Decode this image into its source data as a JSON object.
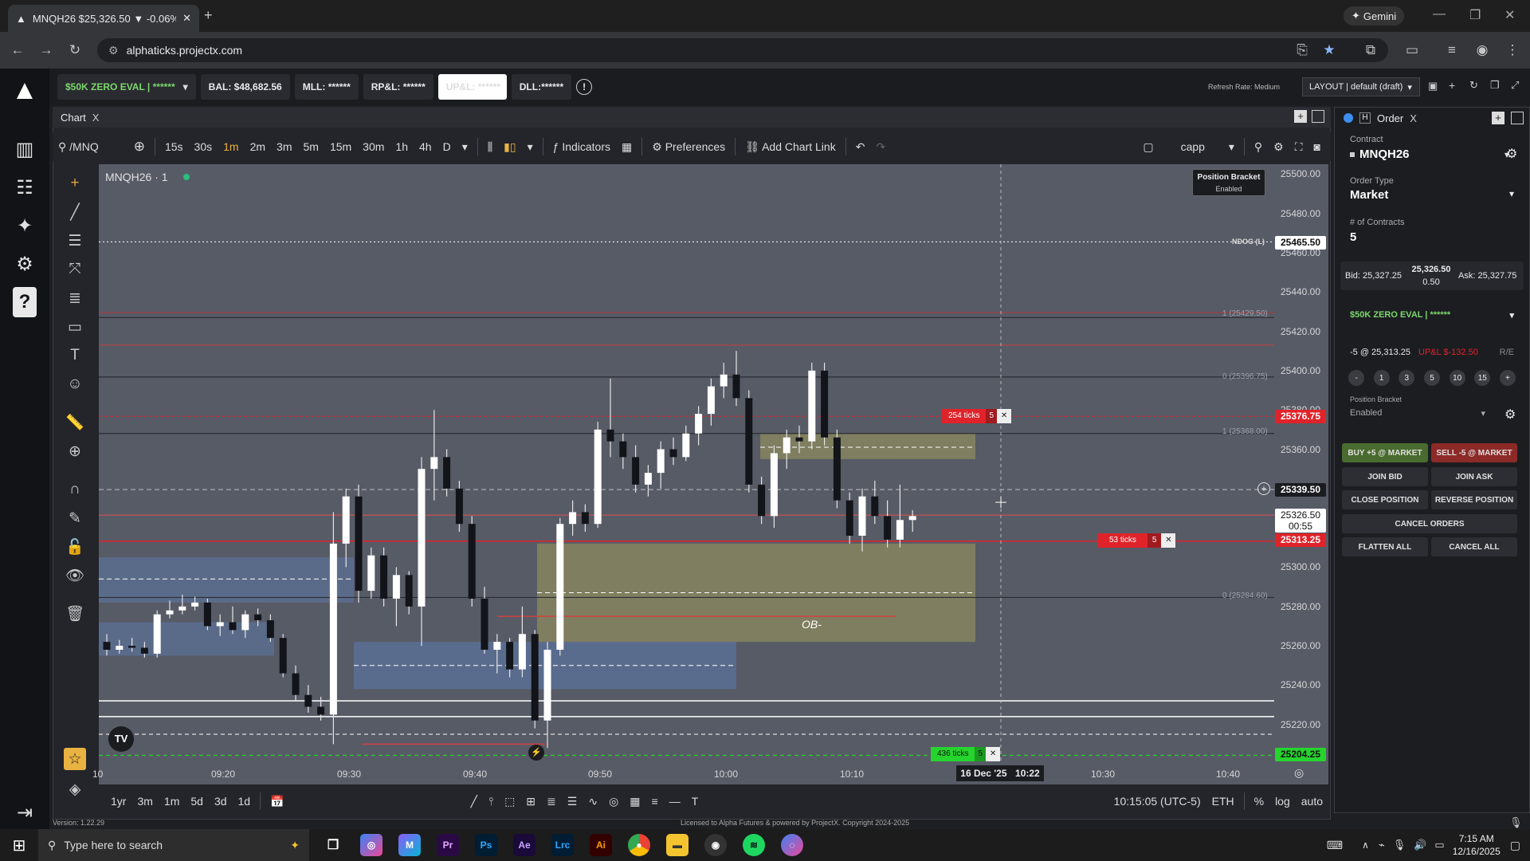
{
  "browser": {
    "tab_title": "MNQH26 $25,326.50 ▼ -0.06%",
    "url": "alphaticks.projectx.com",
    "gemini": "Gemini"
  },
  "account": {
    "name": "$50K ZERO EVAL | ******",
    "bal": "BAL: $48,682.56",
    "mll": "MLL: ******",
    "rpl": "RP&L: ******",
    "upl": "UP&L: ******",
    "dll": "DLL:******",
    "refresh": "Refresh Rate: Medium",
    "layout": "LAYOUT | default (draft)"
  },
  "chart": {
    "tab": "Chart",
    "symbol": "/MNQ",
    "intervals": [
      "15s",
      "30s",
      "1m",
      "2m",
      "3m",
      "5m",
      "15m",
      "30m",
      "1h",
      "4h",
      "D"
    ],
    "active_interval": "1m",
    "indicators": "Indicators",
    "preferences": "Preferences",
    "add_link": "Add Chart Link",
    "template": "capp",
    "legend": "MNQH26 · 1",
    "bracket_note_title": "Position Bracket",
    "bracket_note_sub": "Enabled",
    "ob_label": "OB-",
    "ndog": "NDOG (L)",
    "tag_254": "254 ticks",
    "tag_53": "53 ticks",
    "tag_436": "436 ticks",
    "qty5": "5",
    "price_labels": [
      "25500.00",
      "25480.00",
      "25460.00",
      "25440.00",
      "25420.00",
      "25400.00",
      "25380.00",
      "25360.00",
      "25340.00",
      "25320.00",
      "25300.00",
      "25280.00",
      "25260.00",
      "25240.00",
      "25220.00"
    ],
    "tags": {
      "ndog": "25465.50",
      "r1": "25376.75",
      "cross": "25339.50",
      "last": "25326.50",
      "countdown": "00:55",
      "entry": "25313.25",
      "low": "25204.25"
    },
    "fib_labels": [
      "1 (25429.50)",
      "0 (25396.75)",
      "1 (25368.00)",
      "0 (25284.60)"
    ],
    "time_labels": [
      "10",
      "09:20",
      "09:30",
      "09:40",
      "09:50",
      "10:00",
      "10:10",
      "10:20",
      "10:30",
      "10:40"
    ],
    "cursor_date": "16 Dec '25",
    "cursor_time": "10:22",
    "ranges": [
      "1yr",
      "3m",
      "1m",
      "5d",
      "3d",
      "1d"
    ],
    "clock": "10:15:05 (UTC-5)",
    "session": "ETH",
    "pct": "%",
    "log": "log",
    "auto": "auto",
    "version": "Version: 1.22.29",
    "license": "Licensed to Alpha Futures & powered by ProjectX. Copyright 2024-2025"
  },
  "order": {
    "title": "Order",
    "contract_label": "Contract",
    "contract": "MNQH26",
    "type_label": "Order Type",
    "type": "Market",
    "qty_label": "# of Contracts",
    "qty": "5",
    "bid": "Bid: 25,327.25",
    "mid": "25,326.50",
    "spread": "0.50",
    "ask": "Ask: 25,327.75",
    "account": "$50K ZERO EVAL | ******",
    "position": "-5 @ 25,313.25",
    "upl": "UP&L $-132.50",
    "re": "R/E",
    "qty_buttons": [
      "-",
      "1",
      "3",
      "5",
      "10",
      "15",
      "+"
    ],
    "bracket_label": "Position Bracket",
    "bracket": "Enabled",
    "buy": "BUY +5 @ MARKET",
    "sell": "SELL -5 @ MARKET",
    "join_bid": "JOIN BID",
    "join_ask": "JOIN ASK",
    "close": "CLOSE POSITION",
    "reverse": "REVERSE POSITION",
    "cancel_orders": "CANCEL ORDERS",
    "flatten": "FLATTEN ALL",
    "cancel_all": "CANCEL ALL"
  },
  "taskbar": {
    "search": "Type here to search",
    "time": "7:15 AM",
    "date": "12/16/2025"
  },
  "chart_data": {
    "type": "candlestick",
    "symbol": "MNQH26",
    "timeframe": "1m",
    "ylim": [
      25200,
      25505
    ],
    "candles": [
      {
        "x": 0,
        "o": 25262,
        "h": 25266,
        "l": 25255,
        "c": 25258
      },
      {
        "x": 1,
        "o": 25258,
        "h": 25263,
        "l": 25256,
        "c": 25260
      },
      {
        "x": 2,
        "o": 25260,
        "h": 25264,
        "l": 25257,
        "c": 25259
      },
      {
        "x": 3,
        "o": 25259,
        "h": 25262,
        "l": 25254,
        "c": 25256
      },
      {
        "x": 4,
        "o": 25256,
        "h": 25278,
        "l": 25254,
        "c": 25276
      },
      {
        "x": 5,
        "o": 25276,
        "h": 25283,
        "l": 25274,
        "c": 25278
      },
      {
        "x": 6,
        "o": 25278,
        "h": 25286,
        "l": 25276,
        "c": 25280
      },
      {
        "x": 7,
        "o": 25280,
        "h": 25285,
        "l": 25278,
        "c": 25282
      },
      {
        "x": 8,
        "o": 25282,
        "h": 25284,
        "l": 25268,
        "c": 25270
      },
      {
        "x": 9,
        "o": 25270,
        "h": 25276,
        "l": 25265,
        "c": 25272
      },
      {
        "x": 10,
        "o": 25272,
        "h": 25280,
        "l": 25266,
        "c": 25268
      },
      {
        "x": 11,
        "o": 25268,
        "h": 25278,
        "l": 25264,
        "c": 25276
      },
      {
        "x": 12,
        "o": 25276,
        "h": 25279,
        "l": 25270,
        "c": 25273
      },
      {
        "x": 13,
        "o": 25273,
        "h": 25276,
        "l": 25262,
        "c": 25264
      },
      {
        "x": 14,
        "o": 25264,
        "h": 25266,
        "l": 25244,
        "c": 25246
      },
      {
        "x": 15,
        "o": 25246,
        "h": 25250,
        "l": 25232,
        "c": 25235
      },
      {
        "x": 16,
        "o": 25235,
        "h": 25240,
        "l": 25226,
        "c": 25229
      },
      {
        "x": 17,
        "o": 25229,
        "h": 25234,
        "l": 25222,
        "c": 25225
      },
      {
        "x": 18,
        "o": 25225,
        "h": 25328,
        "l": 25210,
        "c": 25312
      },
      {
        "x": 19,
        "o": 25312,
        "h": 25340,
        "l": 25300,
        "c": 25336
      },
      {
        "x": 20,
        "o": 25336,
        "h": 25342,
        "l": 25282,
        "c": 25288
      },
      {
        "x": 21,
        "o": 25288,
        "h": 25310,
        "l": 25284,
        "c": 25306
      },
      {
        "x": 22,
        "o": 25306,
        "h": 25310,
        "l": 25280,
        "c": 25284
      },
      {
        "x": 23,
        "o": 25284,
        "h": 25300,
        "l": 25270,
        "c": 25296
      },
      {
        "x": 24,
        "o": 25296,
        "h": 25298,
        "l": 25276,
        "c": 25280
      },
      {
        "x": 25,
        "o": 25280,
        "h": 25356,
        "l": 25260,
        "c": 25350
      },
      {
        "x": 26,
        "o": 25350,
        "h": 25380,
        "l": 25334,
        "c": 25356
      },
      {
        "x": 27,
        "o": 25356,
        "h": 25360,
        "l": 25336,
        "c": 25340
      },
      {
        "x": 28,
        "o": 25340,
        "h": 25344,
        "l": 25318,
        "c": 25322
      },
      {
        "x": 29,
        "o": 25322,
        "h": 25326,
        "l": 25280,
        "c": 25284
      },
      {
        "x": 30,
        "o": 25284,
        "h": 25290,
        "l": 25256,
        "c": 25258
      },
      {
        "x": 31,
        "o": 25258,
        "h": 25266,
        "l": 25246,
        "c": 25262
      },
      {
        "x": 32,
        "o": 25262,
        "h": 25264,
        "l": 25244,
        "c": 25248
      },
      {
        "x": 33,
        "o": 25248,
        "h": 25280,
        "l": 25244,
        "c": 25266
      },
      {
        "x": 34,
        "o": 25266,
        "h": 25268,
        "l": 25218,
        "c": 25222
      },
      {
        "x": 35,
        "o": 25222,
        "h": 25262,
        "l": 25208,
        "c": 25258
      },
      {
        "x": 36,
        "o": 25258,
        "h": 25325,
        "l": 25255,
        "c": 25322
      },
      {
        "x": 37,
        "o": 25322,
        "h": 25334,
        "l": 25316,
        "c": 25328
      },
      {
        "x": 38,
        "o": 25328,
        "h": 25332,
        "l": 25318,
        "c": 25322
      },
      {
        "x": 39,
        "o": 25322,
        "h": 25374,
        "l": 25320,
        "c": 25370
      },
      {
        "x": 40,
        "o": 25370,
        "h": 25396,
        "l": 25356,
        "c": 25364
      },
      {
        "x": 41,
        "o": 25364,
        "h": 25368,
        "l": 25350,
        "c": 25356
      },
      {
        "x": 42,
        "o": 25356,
        "h": 25362,
        "l": 25338,
        "c": 25342
      },
      {
        "x": 43,
        "o": 25342,
        "h": 25352,
        "l": 25336,
        "c": 25348
      },
      {
        "x": 44,
        "o": 25348,
        "h": 25364,
        "l": 25340,
        "c": 25360
      },
      {
        "x": 45,
        "o": 25360,
        "h": 25366,
        "l": 25352,
        "c": 25356
      },
      {
        "x": 46,
        "o": 25356,
        "h": 25372,
        "l": 25354,
        "c": 25368
      },
      {
        "x": 47,
        "o": 25368,
        "h": 25382,
        "l": 25362,
        "c": 25378
      },
      {
        "x": 48,
        "o": 25378,
        "h": 25396,
        "l": 25372,
        "c": 25392
      },
      {
        "x": 49,
        "o": 25392,
        "h": 25404,
        "l": 25386,
        "c": 25398
      },
      {
        "x": 50,
        "o": 25398,
        "h": 25410,
        "l": 25382,
        "c": 25386
      },
      {
        "x": 51,
        "o": 25386,
        "h": 25390,
        "l": 25338,
        "c": 25342
      },
      {
        "x": 52,
        "o": 25342,
        "h": 25346,
        "l": 25322,
        "c": 25326
      },
      {
        "x": 53,
        "o": 25326,
        "h": 25362,
        "l": 25320,
        "c": 25358
      },
      {
        "x": 54,
        "o": 25358,
        "h": 25370,
        "l": 25350,
        "c": 25366
      },
      {
        "x": 55,
        "o": 25366,
        "h": 25372,
        "l": 25358,
        "c": 25364
      },
      {
        "x": 56,
        "o": 25364,
        "h": 25404,
        "l": 25360,
        "c": 25400
      },
      {
        "x": 57,
        "o": 25400,
        "h": 25404,
        "l": 25362,
        "c": 25366
      },
      {
        "x": 58,
        "o": 25366,
        "h": 25370,
        "l": 25330,
        "c": 25334
      },
      {
        "x": 59,
        "o": 25334,
        "h": 25338,
        "l": 25312,
        "c": 25316
      },
      {
        "x": 60,
        "o": 25316,
        "h": 25340,
        "l": 25308,
        "c": 25336
      },
      {
        "x": 61,
        "o": 25336,
        "h": 25344,
        "l": 25322,
        "c": 25326
      },
      {
        "x": 62,
        "o": 25326,
        "h": 25334,
        "l": 25310,
        "c": 25314
      },
      {
        "x": 63,
        "o": 25314,
        "h": 25342,
        "l": 25310,
        "c": 25324
      },
      {
        "x": 64,
        "o": 25324,
        "h": 25329,
        "l": 25318,
        "c": 25326
      }
    ]
  }
}
